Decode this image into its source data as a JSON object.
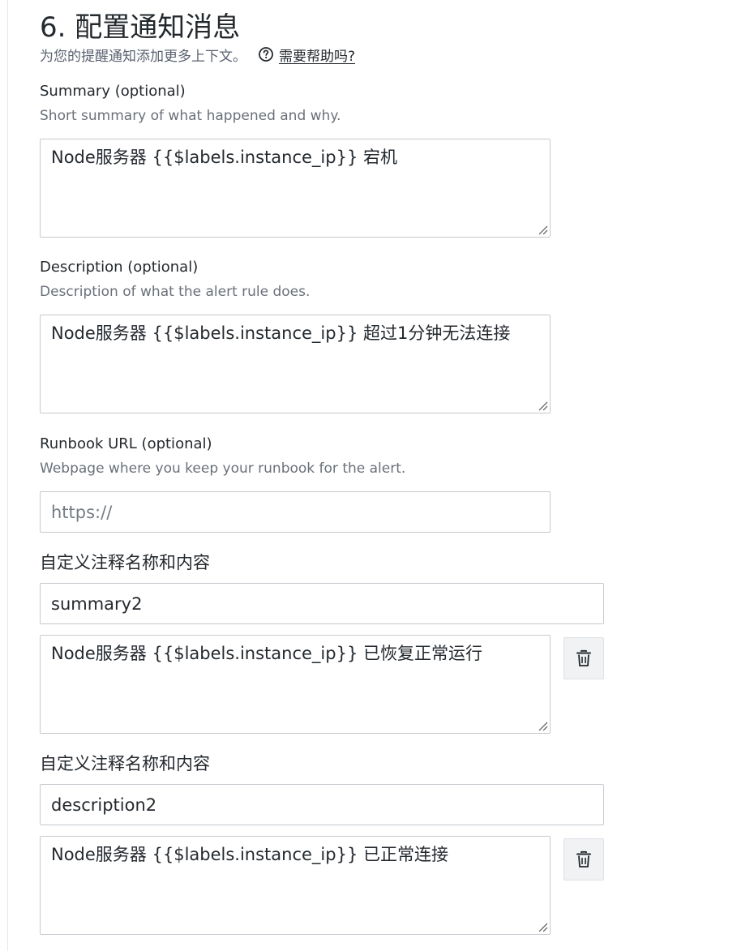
{
  "section": {
    "title": "6. 配置通知消息",
    "subtitle": "为您的提醒通知添加更多上下文。",
    "help_link": "需要帮助吗?",
    "help_icon": "question-circle-icon"
  },
  "summary": {
    "label": "Summary (optional)",
    "description": "Short summary of what happened and why.",
    "value": "Node服务器 {{$labels.instance_ip}} 宕机"
  },
  "description": {
    "label": "Description (optional)",
    "description": "Description of what the alert rule does.",
    "value": "Node服务器 {{$labels.instance_ip}} 超过1分钟无法连接"
  },
  "runbook": {
    "label": "Runbook URL (optional)",
    "description": "Webpage where you keep your runbook for the alert.",
    "value": "",
    "placeholder": "https://"
  },
  "custom_annotations": [
    {
      "heading": "自定义注释名称和内容",
      "name": "summary2",
      "content": "Node服务器 {{$labels.instance_ip}} 已恢复正常运行",
      "delete_icon": "trash-icon"
    },
    {
      "heading": "自定义注释名称和内容",
      "name": "description2",
      "content": "Node服务器 {{$labels.instance_ip}} 已正常连接",
      "delete_icon": "trash-icon"
    }
  ]
}
